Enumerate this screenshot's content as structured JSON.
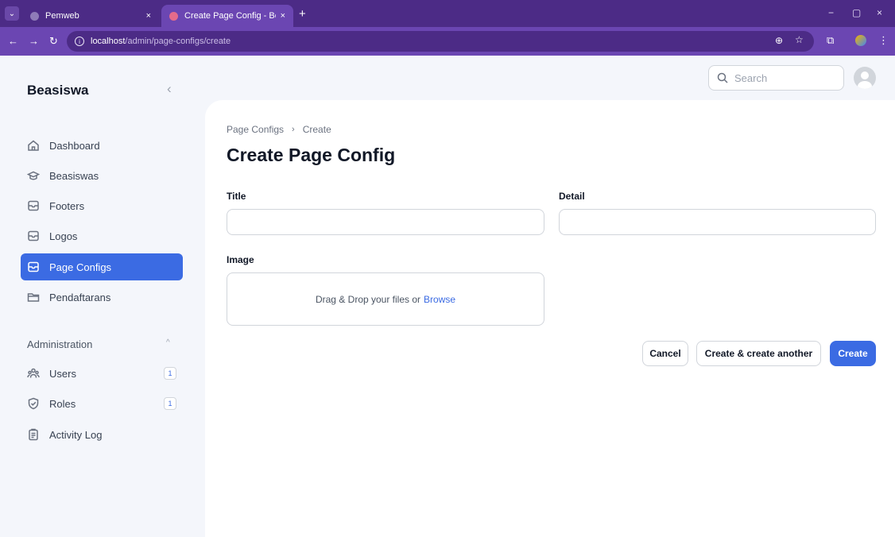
{
  "browser": {
    "tabs": [
      {
        "label": "Pemweb",
        "close": "×"
      },
      {
        "label": "Create Page Config - Beasiswa",
        "close": "×"
      }
    ],
    "new_tab": "+",
    "url_host": "localhost",
    "url_path": "/admin/page-configs/create",
    "window_controls": {
      "minimize": "−",
      "restore": "▢",
      "close": "×"
    }
  },
  "sidebar": {
    "brand": "Beasiswa",
    "collapse_glyph": "‹",
    "items": [
      {
        "label": "Dashboard",
        "icon": "home-icon",
        "active": false
      },
      {
        "label": "Beasiswas",
        "icon": "graduation-cap-icon",
        "active": false
      },
      {
        "label": "Footers",
        "icon": "inbox-icon",
        "active": false
      },
      {
        "label": "Logos",
        "icon": "inbox-icon",
        "active": false
      },
      {
        "label": "Page Configs",
        "icon": "inbox-icon",
        "active": true
      },
      {
        "label": "Pendaftarans",
        "icon": "folder-icon",
        "active": false
      }
    ],
    "admin_group": {
      "title": "Administration",
      "chevron": "^",
      "items": [
        {
          "label": "Users",
          "icon": "users-icon",
          "count": "1"
        },
        {
          "label": "Roles",
          "icon": "shield-check-icon",
          "count": "1"
        },
        {
          "label": "Activity Log",
          "icon": "clipboard-icon"
        }
      ]
    }
  },
  "topbar": {
    "search_placeholder": "Search"
  },
  "main": {
    "breadcrumb": [
      "Page Configs",
      "Create"
    ],
    "breadcrumb_sep": "›",
    "title": "Create Page Config",
    "fields": {
      "title_label": "Title",
      "title_value": "",
      "detail_label": "Detail",
      "detail_value": "",
      "image_label": "Image",
      "dropzone_text": "Drag & Drop your files or",
      "dropzone_link": "Browse"
    },
    "buttons": {
      "cancel": "Cancel",
      "create_another": "Create & create another",
      "create": "Create"
    }
  },
  "colors": {
    "primary": "#3b6be3",
    "chrome_dark": "#4c2b86",
    "chrome_light": "#6b46b2"
  }
}
